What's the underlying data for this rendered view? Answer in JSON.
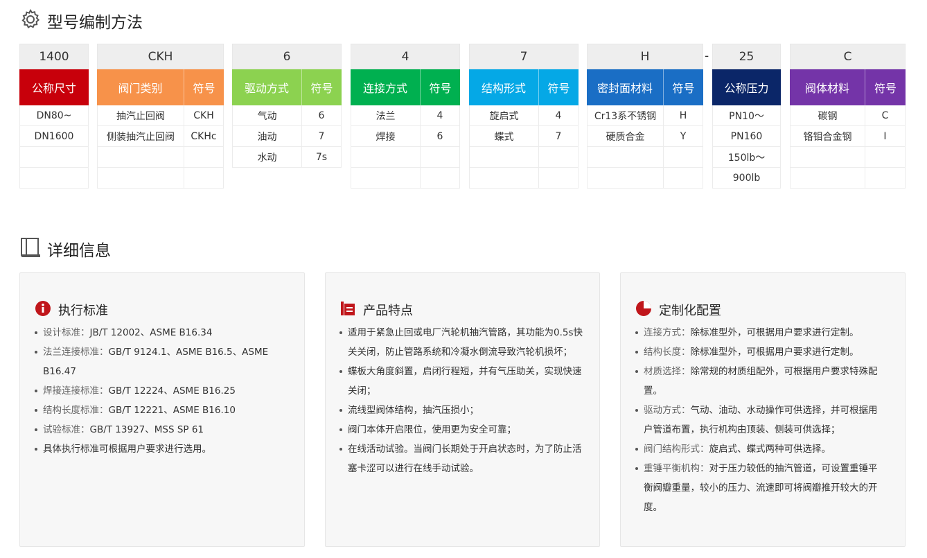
{
  "model": {
    "title": "型号编制方法",
    "groups": [
      {
        "id": "size",
        "code": "1400",
        "header": "公称尺寸",
        "color": "#c8000b",
        "rows": [
          [
            "DN80~"
          ],
          [
            "DN1600"
          ],
          [
            ""
          ],
          [
            ""
          ]
        ]
      },
      {
        "id": "type",
        "code": "CKH",
        "header": "阀门类别",
        "symbol_header": "符号",
        "color": "#f7924a",
        "rows": [
          [
            "抽汽止回阀",
            "CKH"
          ],
          [
            "侧装抽汽止回阀",
            "CKHc"
          ],
          [
            "",
            ""
          ],
          [
            "",
            ""
          ]
        ]
      },
      {
        "id": "drive",
        "code": "6",
        "header": "驱动方式",
        "symbol_header": "符号",
        "color": "#8cd250",
        "rows": [
          [
            "气动",
            "6"
          ],
          [
            "油动",
            "7"
          ],
          [
            "水动",
            "7s"
          ]
        ]
      },
      {
        "id": "connect",
        "code": "4",
        "header": "连接方式",
        "symbol_header": "符号",
        "color": "#00b050",
        "rows": [
          [
            "法兰",
            "4"
          ],
          [
            "焊接",
            "6"
          ],
          [
            "",
            ""
          ],
          [
            "",
            ""
          ]
        ]
      },
      {
        "id": "structure",
        "code": "7",
        "header": "结构形式",
        "symbol_header": "符号",
        "color": "#05a8e6",
        "rows": [
          [
            "旋启式",
            "4"
          ],
          [
            "蝶式",
            "7"
          ],
          [
            "",
            ""
          ],
          [
            "",
            ""
          ]
        ]
      },
      {
        "id": "seal",
        "code": "H",
        "header": "密封面材料",
        "symbol_header": "符号",
        "color": "#1a6ec5",
        "rows": [
          [
            "Cr13系不锈钢",
            "H"
          ],
          [
            "硬质合金",
            "Y"
          ],
          [
            "",
            ""
          ],
          [
            "",
            ""
          ]
        ]
      },
      {
        "id": "pressure",
        "code": "25",
        "header": "公称压力",
        "color": "#0b2668",
        "rows": [
          [
            "PN10～"
          ],
          [
            "PN160"
          ],
          [
            "150lb～"
          ],
          [
            "900lb"
          ]
        ]
      },
      {
        "id": "body",
        "code": "C",
        "header": "阀体材料",
        "symbol_header": "符号",
        "color": "#7434a8",
        "rows": [
          [
            "碳钢",
            "C"
          ],
          [
            "铬钼合金钢",
            "I"
          ],
          [
            "",
            ""
          ],
          [
            "",
            ""
          ]
        ]
      }
    ],
    "separator": "-"
  },
  "details": {
    "title": "详细信息",
    "cards": [
      {
        "title": "执行标准",
        "icon": "info-icon",
        "icon_color": "#c0161b",
        "items": [
          {
            "label": "设计标准：",
            "text": "JB/T 12002、ASME B16.34"
          },
          {
            "label": "法兰连接标准：",
            "text": "GB/T 9124.1、ASME B16.5、ASME B16.47"
          },
          {
            "label": "焊接连接标准：",
            "text": "GB/T 12224、ASME B16.25"
          },
          {
            "label": "结构长度标准：",
            "text": "GB/T 12221、ASME B16.10"
          },
          {
            "label": "试验标准：",
            "text": "GB/T 13927、MSS SP 61"
          },
          {
            "label": "",
            "text": "具体执行标准可根据用户要求进行选用。"
          }
        ]
      },
      {
        "title": "产品特点",
        "icon": "document-icon",
        "icon_color": "#c0161b",
        "items": [
          {
            "label": "",
            "text": "适用于紧急止回或电厂汽轮机抽汽管路，其功能为0.5s快关关闭，防止管路系统和冷凝水倒流导致汽轮机损坏；"
          },
          {
            "label": "",
            "text": "蝶板大角度斜置，启闭行程短，并有气压助关，实现快速关闭；"
          },
          {
            "label": "",
            "text": "流线型阀体结构，抽汽压损小；"
          },
          {
            "label": "",
            "text": "阀门本体开启限位，使用更为安全可靠；"
          },
          {
            "label": "",
            "text": "在线活动试验。当阀门长期处于开启状态时，为了防止活塞卡涩可以进行在线手动试验。"
          }
        ]
      },
      {
        "title": "定制化配置",
        "icon": "pie-chart-icon",
        "icon_color": "#c0161b",
        "items": [
          {
            "label": "连接方式：",
            "text": "除标准型外，可根据用户要求进行定制。"
          },
          {
            "label": "结构长度：",
            "text": "除标准型外，可根据用户要求进行定制。"
          },
          {
            "label": "材质选择：",
            "text": "除常规的材质组配外，可根据用户要求特殊配置。"
          },
          {
            "label": "驱动方式：",
            "text": "气动、油动、水动操作可供选择，并可根据用户管道布置，执行机构由顶装、侧装可供选择；"
          },
          {
            "label": "阀门结构形式：",
            "text": "旋启式、蝶式两种可供选择。"
          },
          {
            "label": "重锤平衡机构：",
            "text": "对于压力较低的抽汽管道，可设置重锤平衡阀瓣重量，较小的压力、流速即可将阀瓣推开较大的开度。"
          }
        ]
      }
    ]
  }
}
